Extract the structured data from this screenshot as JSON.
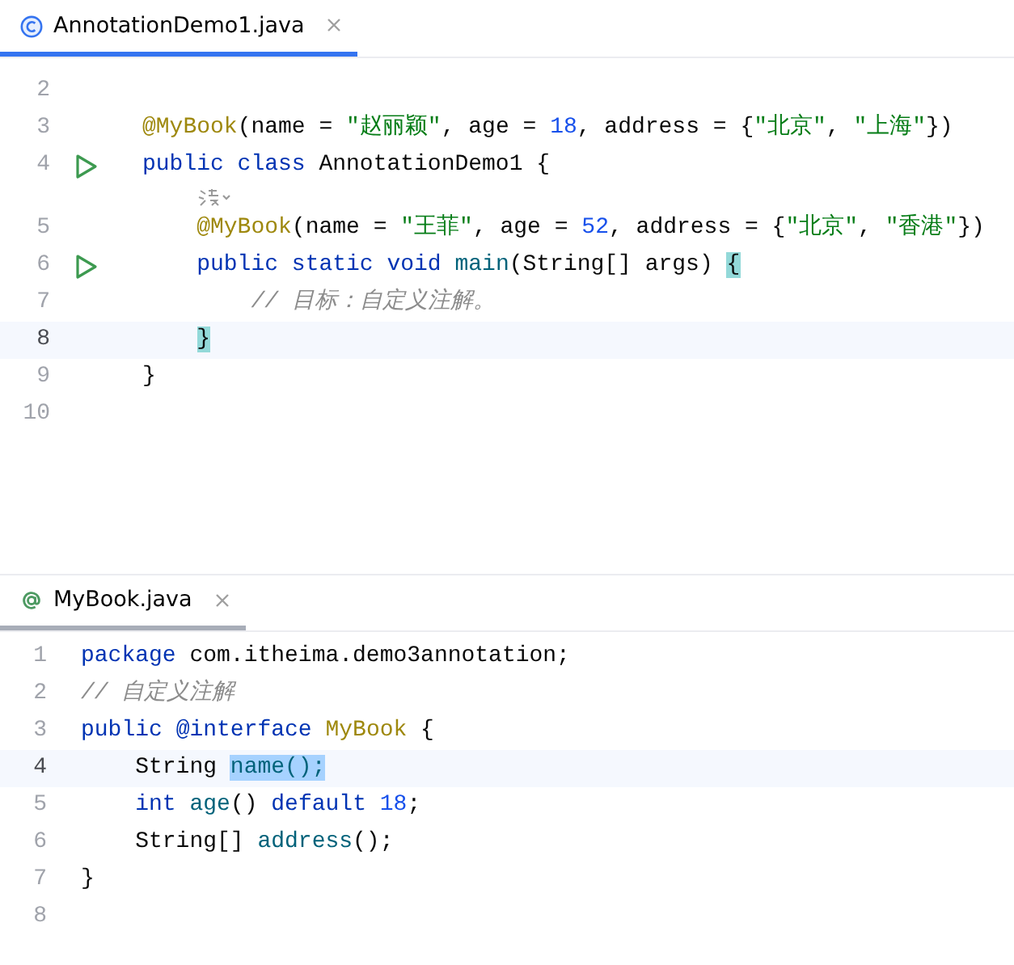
{
  "editors": [
    {
      "focused": true,
      "tab": {
        "label": "AnnotationDemo1.java",
        "kind": "class",
        "selected": true
      },
      "lines": [
        {
          "kind": "code",
          "number": "2",
          "run": false,
          "current": false
        },
        {
          "kind": "code",
          "number": "3",
          "run": false,
          "current": false,
          "tokens": [
            {
              "t": "@MyBook",
              "kind": "annotation"
            },
            {
              "t": "(name = ",
              "kind": "text"
            },
            {
              "t": "\"赵丽颖\"",
              "kind": "string"
            },
            {
              "t": ", age = ",
              "kind": "text"
            },
            {
              "t": "18",
              "kind": "number"
            },
            {
              "t": ", address = {",
              "kind": "text"
            },
            {
              "t": "\"北京\"",
              "kind": "string"
            },
            {
              "t": ", ",
              "kind": "text"
            },
            {
              "t": "\"上海\"",
              "kind": "string"
            },
            {
              "t": "})",
              "kind": "text"
            }
          ]
        },
        {
          "kind": "code",
          "number": "4",
          "run": true,
          "current": false,
          "tokens": [
            {
              "t": "public class ",
              "kind": "keyword"
            },
            {
              "t": "AnnotationDemo1 {",
              "kind": "text"
            }
          ]
        },
        {
          "kind": "hint"
        },
        {
          "kind": "code",
          "number": "5",
          "run": false,
          "current": false,
          "tokens": [
            {
              "t": "    @MyBook",
              "kind": "annotation"
            },
            {
              "t": "(name = ",
              "kind": "text"
            },
            {
              "t": "\"王菲\"",
              "kind": "string"
            },
            {
              "t": ", age = ",
              "kind": "text"
            },
            {
              "t": "52",
              "kind": "number"
            },
            {
              "t": ", address = {",
              "kind": "text"
            },
            {
              "t": "\"北京\"",
              "kind": "string"
            },
            {
              "t": ", ",
              "kind": "text"
            },
            {
              "t": "\"香港\"",
              "kind": "string"
            },
            {
              "t": "})",
              "kind": "text"
            }
          ]
        },
        {
          "kind": "code",
          "number": "6",
          "run": true,
          "current": false,
          "tokens": [
            {
              "t": "    public static void ",
              "kind": "keyword"
            },
            {
              "t": "main",
              "kind": "method"
            },
            {
              "t": "(String[] args) ",
              "kind": "text"
            },
            {
              "t": "{",
              "kind": "matched_brace"
            }
          ]
        },
        {
          "kind": "code",
          "number": "7",
          "run": false,
          "current": false,
          "tokens": [
            {
              "t": "        // 目标：自定义注解。",
              "kind": "comment"
            }
          ]
        },
        {
          "kind": "code",
          "number": "8",
          "run": false,
          "current": true,
          "tokens": [
            {
              "t": "    }",
              "kind": "matched_brace"
            }
          ]
        },
        {
          "kind": "code",
          "number": "9",
          "run": false,
          "current": false,
          "tokens": [
            {
              "t": "}",
              "kind": "text"
            }
          ]
        },
        {
          "kind": "code",
          "number": "10",
          "run": false,
          "current": false
        }
      ]
    },
    {
      "focused": false,
      "tab": {
        "label": "MyBook.java",
        "kind": "annotation",
        "selected": true
      },
      "lines": [
        {
          "kind": "code",
          "number": "1",
          "run": false,
          "current": false,
          "tokens": [
            {
              "t": "package ",
              "kind": "keyword"
            },
            {
              "t": "com.itheima.demo3annotation;",
              "kind": "text"
            }
          ]
        },
        {
          "kind": "code",
          "number": "2",
          "run": false,
          "current": false,
          "tokens": [
            {
              "t": "// 自定义注解",
              "kind": "comment"
            }
          ]
        },
        {
          "kind": "code",
          "number": "3",
          "run": false,
          "current": false,
          "tokens": [
            {
              "t": "public ",
              "kind": "keyword"
            },
            {
              "t": "@interface ",
              "kind": "keyword"
            },
            {
              "t": "MyBook",
              "kind": "annotation"
            },
            {
              "t": " {",
              "kind": "text"
            }
          ]
        },
        {
          "kind": "code",
          "number": "4",
          "run": false,
          "current": true,
          "tokens": [
            {
              "t": "    String ",
              "kind": "text"
            },
            {
              "t": "name();",
              "kind": "selected"
            }
          ]
        },
        {
          "kind": "code",
          "number": "5",
          "run": false,
          "current": false,
          "tokens": [
            {
              "t": "    int ",
              "kind": "keyword"
            },
            {
              "t": "age",
              "kind": "method"
            },
            {
              "t": "() ",
              "kind": "text"
            },
            {
              "t": "default ",
              "kind": "keyword"
            },
            {
              "t": "18",
              "kind": "number"
            },
            {
              "t": ";",
              "kind": "text"
            }
          ]
        },
        {
          "kind": "code",
          "number": "6",
          "run": false,
          "current": false,
          "tokens": [
            {
              "t": "    String[] ",
              "kind": "text"
            },
            {
              "t": "address",
              "kind": "method"
            },
            {
              "t": "();",
              "kind": "text"
            }
          ]
        },
        {
          "kind": "code",
          "number": "7",
          "run": false,
          "current": false,
          "tokens": [
            {
              "t": "}",
              "kind": "text"
            }
          ]
        },
        {
          "kind": "code",
          "number": "8",
          "run": false,
          "current": false
        }
      ]
    }
  ]
}
